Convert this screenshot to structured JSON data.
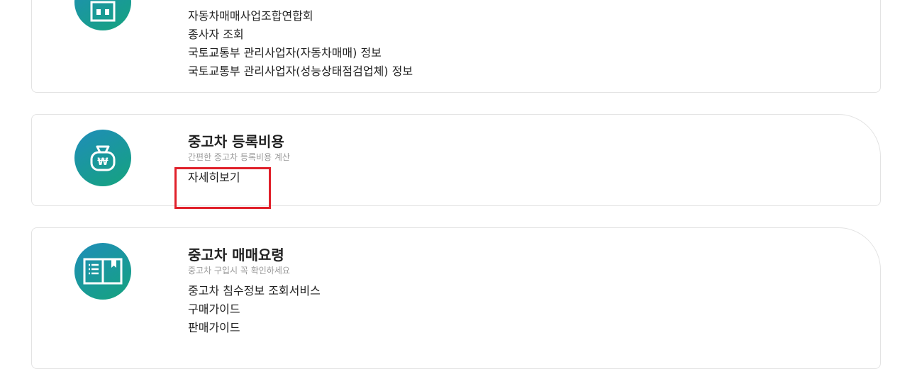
{
  "cards": [
    {
      "icon": "building-icon",
      "links": [
        "자동차매매사업조합연합회",
        "종사자 조회",
        "국토교통부 관리사업자(자동차매매) 정보",
        "국토교통부 관리사업자(성능상태점검업체) 정보"
      ]
    },
    {
      "icon": "money-bag-won-icon",
      "title": "중고차 등록비용",
      "subtitle": "간편한 중고차 등록비용 계산",
      "links": [
        "자세히보기"
      ]
    },
    {
      "icon": "guide-book-icon",
      "title": "중고차 매매요령",
      "subtitle": "중고차 구입시 꼭 확인하세요",
      "links": [
        "중고차 침수정보 조회서비스",
        "구매가이드",
        "판매가이드"
      ]
    }
  ],
  "colors": {
    "icon_gradient_start": "#1f8db9",
    "icon_gradient_end": "#15a37e",
    "highlight": "#e0202a"
  }
}
